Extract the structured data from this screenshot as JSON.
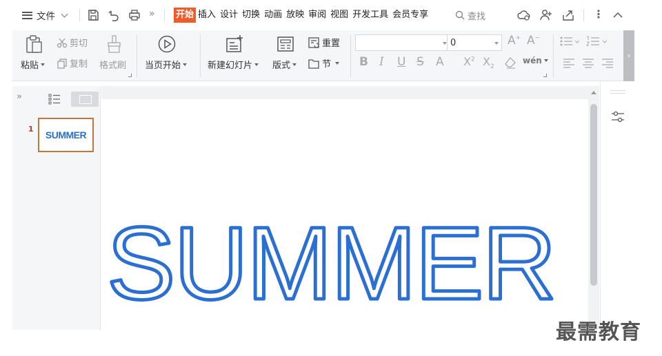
{
  "menubar": {
    "file_label": "文件",
    "tabs": [
      {
        "label": "开始",
        "active": true
      },
      {
        "label": "插入"
      },
      {
        "label": "设计"
      },
      {
        "label": "切换"
      },
      {
        "label": "动画"
      },
      {
        "label": "放映"
      },
      {
        "label": "审阅"
      },
      {
        "label": "视图"
      },
      {
        "label": "开发工具"
      },
      {
        "label": "会员专享"
      }
    ],
    "search_label": "查找",
    "active_color": "#f15b2b"
  },
  "ribbon": {
    "paste": "粘贴",
    "cut": "剪切",
    "copy": "复制",
    "format_painter": "格式刷",
    "play_current": "当页开始",
    "new_slide": "新建幻灯片",
    "layout": "版式",
    "reset": "重置",
    "section": "节",
    "font_name": "",
    "font_size": "0",
    "phonetic": "wén"
  },
  "slides": {
    "thumbnails": [
      {
        "number": "1",
        "text": "SUMMER"
      }
    ],
    "main_text": "SUMMER",
    "text_outline_color": "#2a6fd1"
  },
  "watermark": "最需教育"
}
